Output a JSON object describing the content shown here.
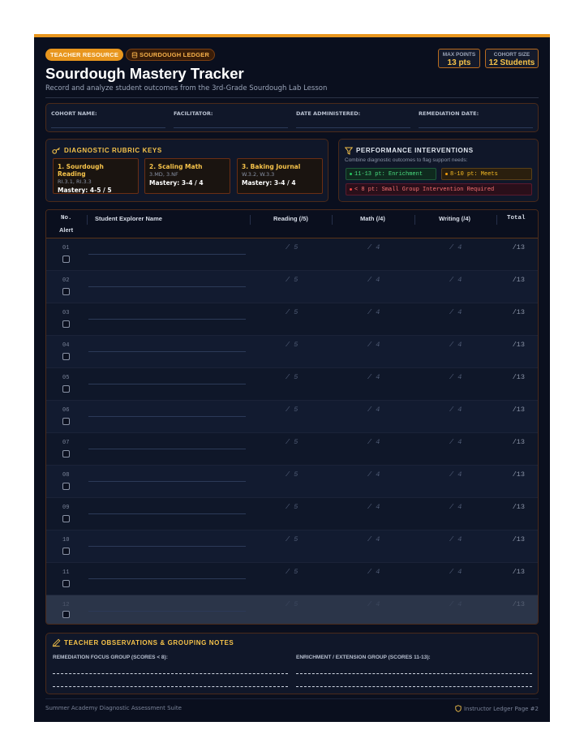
{
  "header": {
    "badge_resource": "TEACHER RESOURCE",
    "badge_ledger": "SOURDOUGH LEDGER",
    "max_points_label": "MAX POINTS",
    "max_points_value": "13 pts",
    "cohort_size_label": "COHORT SIZE",
    "cohort_size_value": "12 Students",
    "title": "Sourdough Mastery Tracker",
    "subtitle": "Record and analyze student outcomes from the 3rd-Grade Sourdough Lab Lesson"
  },
  "info_fields": [
    "COHORT NAME:",
    "FACILITATOR:",
    "DATE ADMINISTERED:",
    "REMEDIATION DATE:"
  ],
  "rubric": {
    "title": "DIAGNOSTIC RUBRIC KEYS",
    "cards": [
      {
        "title": "1. Sourdough Reading",
        "standards": "RI.3.1, RI.3.3",
        "mastery": "Mastery: 4-5 / 5"
      },
      {
        "title": "2. Scaling Math",
        "standards": "3.MD, 3.NF",
        "mastery": "Mastery: 3-4 / 4"
      },
      {
        "title": "3. Baking Journal",
        "standards": "W.3.2, W.3.3",
        "mastery": "Mastery: 3-4 / 4"
      }
    ]
  },
  "interventions": {
    "title": "PERFORMANCE INTERVENTIONS",
    "subtitle": "Combine diagnostic outcomes to flag support needs:",
    "chips": {
      "enrichment": "11-13 pt: Enrichment",
      "meets": "8-10 pt: Meets",
      "small_group": "< 8 pt: Small Group Intervention Required"
    },
    "colors": {
      "enrichment": "#22c55e",
      "meets": "#f59e0b",
      "small_group": "#ef4444"
    }
  },
  "table": {
    "headers": {
      "no": "No.",
      "alert": "Alert",
      "name": "Student Explorer Name",
      "reading": "Reading (/5)",
      "math": "Math (/4)",
      "writing": "Writing (/4)",
      "total": "Total"
    },
    "rows": [
      {
        "num": "01",
        "reading": "/ 5",
        "math": "/ 4",
        "writing": "/ 4",
        "total": "/13"
      },
      {
        "num": "02",
        "reading": "/ 5",
        "math": "/ 4",
        "writing": "/ 4",
        "total": "/13"
      },
      {
        "num": "03",
        "reading": "/ 5",
        "math": "/ 4",
        "writing": "/ 4",
        "total": "/13"
      },
      {
        "num": "04",
        "reading": "/ 5",
        "math": "/ 4",
        "writing": "/ 4",
        "total": "/13"
      },
      {
        "num": "05",
        "reading": "/ 5",
        "math": "/ 4",
        "writing": "/ 4",
        "total": "/13"
      },
      {
        "num": "06",
        "reading": "/ 5",
        "math": "/ 4",
        "writing": "/ 4",
        "total": "/13"
      },
      {
        "num": "07",
        "reading": "/ 5",
        "math": "/ 4",
        "writing": "/ 4",
        "total": "/13"
      },
      {
        "num": "08",
        "reading": "/ 5",
        "math": "/ 4",
        "writing": "/ 4",
        "total": "/13"
      },
      {
        "num": "09",
        "reading": "/ 5",
        "math": "/ 4",
        "writing": "/ 4",
        "total": "/13"
      },
      {
        "num": "10",
        "reading": "/ 5",
        "math": "/ 4",
        "writing": "/ 4",
        "total": "/13"
      },
      {
        "num": "11",
        "reading": "/ 5",
        "math": "/ 4",
        "writing": "/ 4",
        "total": "/13"
      },
      {
        "num": "12",
        "reading": "/ 5",
        "math": "/ 4",
        "writing": "/ 4",
        "total": "/13"
      }
    ]
  },
  "notes": {
    "title": "TEACHER OBSERVATIONS & GROUPING NOTES",
    "remediation_label": "REMEDIATION FOCUS GROUP (SCORES < 8):",
    "enrichment_label": "ENRICHMENT / EXTENSION GROUP (SCORES 11-13):"
  },
  "footer": {
    "left": "Summer Academy Diagnostic Assessment Suite",
    "right": "Instructor Ledger Page #2"
  },
  "colors": {
    "accent": "#e8961e",
    "gold": "#f6c34a",
    "background": "#0a0f1e"
  }
}
